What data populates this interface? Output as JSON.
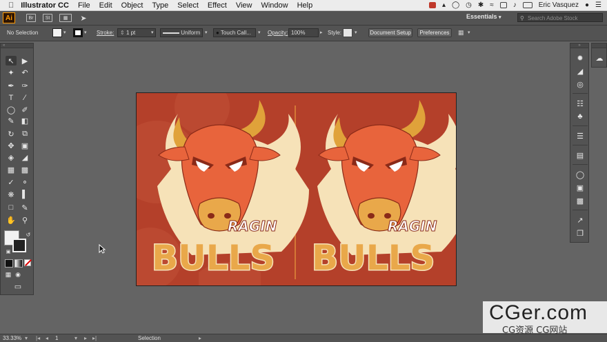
{
  "menubar": {
    "app_name": "Illustrator CC",
    "items": [
      "File",
      "Edit",
      "Object",
      "Type",
      "Select",
      "Effect",
      "View",
      "Window",
      "Help"
    ],
    "user": "Eric Vasquez"
  },
  "appbar": {
    "logo": "Ai",
    "workspace": "Essentials",
    "search_placeholder": "Search Adobe Stock"
  },
  "control_bar": {
    "selection_label": "No Selection",
    "stroke_label": "Stroke:",
    "stroke_value": "1 pt",
    "profile": "Uniform",
    "brush": "Touch Call...",
    "opacity_label": "Opacity:",
    "opacity_value": "100%",
    "style_label": "Style:",
    "document_setup": "Document Setup",
    "preferences": "Preferences"
  },
  "artwork": {
    "word_top": "RAGIN",
    "word_main": "BULLS"
  },
  "status": {
    "zoom": "33.33%",
    "artboard": "1",
    "tool": "Selection"
  },
  "watermark": {
    "line1": "CGer.com",
    "line2": "CG资源 CG网站"
  },
  "colors": {
    "artboard_bg": "#b4402a",
    "bull_orange": "#e8643c",
    "horn_gold": "#e0a23a",
    "text_gold": "#e9a84a",
    "outline_cream": "#f6e2b8"
  }
}
